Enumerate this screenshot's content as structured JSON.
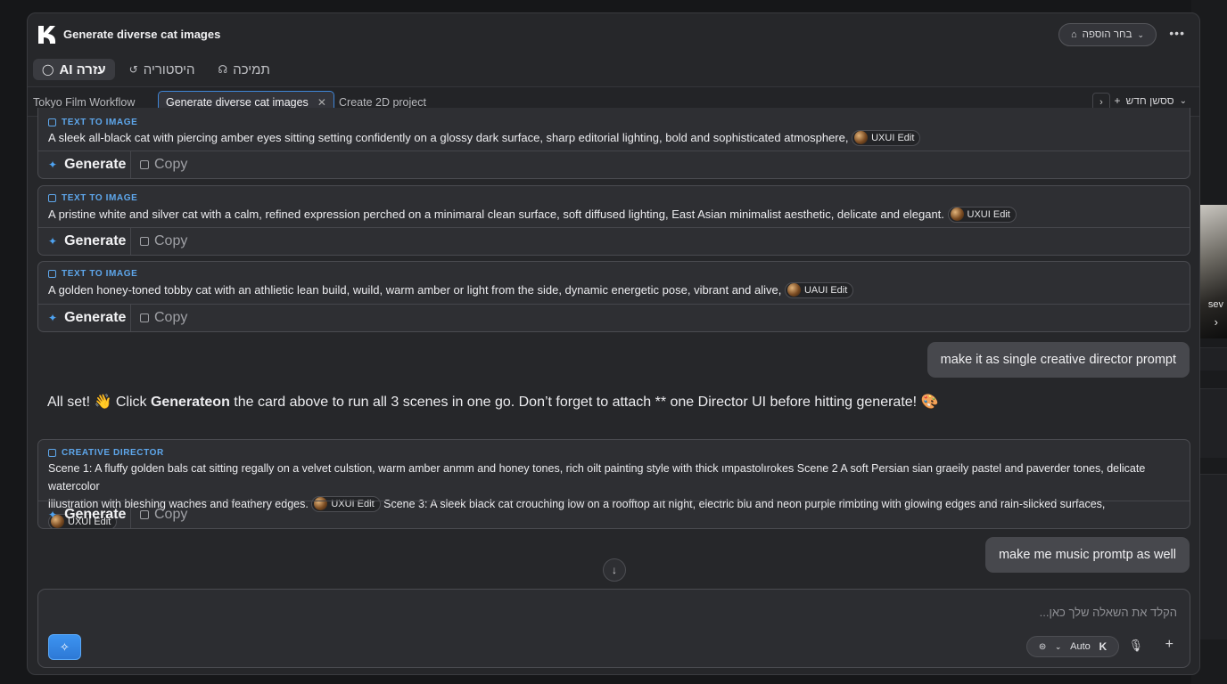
{
  "header": {
    "title": "Generate diverse cat images",
    "model_select": "בחר הוספה",
    "more": "•••"
  },
  "nav_tabs": [
    {
      "label": "AI עזרה",
      "icon": "chat-icon"
    },
    {
      "label": "היסטוריה",
      "icon": "history-icon"
    },
    {
      "label": "תמיכה",
      "icon": "headset-icon"
    }
  ],
  "workspace_tabs": {
    "items": [
      "Tokyo Film Workflow",
      "Generate diverse cat images",
      "Create 2D project"
    ],
    "new_chat": "ססשן חדש"
  },
  "cards": [
    {
      "kind": "TEXT TO IMAGE",
      "text": "A sleek all-black cat with piercing amber eyes sitting setting confidently on a glossy dark surface, sharp editorial lighting, bold and sophisticated atmosphere,",
      "chip": "UXUI Edit",
      "generate": "Generate",
      "copy": "Copy"
    },
    {
      "kind": "TEXT TO IMAGE",
      "text": "A pristine white and silver cat with a calm, refined expression perched on a minimaral clean surface, soft diffused lighting, East Asian minimalist aesthetic, delicate and elegant.",
      "chip": "UXUI Edit",
      "generate": "Generate",
      "copy": "Copy"
    },
    {
      "kind": "TEXT TO IMAGE",
      "text": "A golden honey-toned tobby cat with an athlietic lean build, wuild, warm amber or light from the side, dynamic energetic pose, vibrant and alive,",
      "chip": "UAUI Edit",
      "generate": "Generate",
      "copy": "Copy"
    }
  ],
  "user_message_1": "make it as single creative director prompt",
  "ai_message": {
    "prefix": "All set! 👋 Click ",
    "bold": "Generateon",
    "suffix": " the card above to run all 3 scenes in one go. Don’t forget to attach ** one Director UI before hitting generate! 🎨"
  },
  "director_card": {
    "kind": "CREATIVE DIRECTOR",
    "text_line1": "Scene 1: A fluffy golden bals cat sitting regally on a velvet culstion, warm amber anmm and honey tones, rich oilt painting style with thick ımpastolırokes Scene 2 A soft Persian sian graeily pastel and paverder tones, delicate watercolor",
    "text_line2a": "illustration with bleshing waches and feathery edges.",
    "chip1": "UXUI Edit",
    "text_line2b": "Scene 3: A sleek black cat crouching low on a roofftop aıt night, electric blu and neon purple rimbting with glowing edges and rain-slicked surfaces,",
    "chip2": "UXUI Edit",
    "generate": "Generate",
    "copy": "Copy"
  },
  "user_message_2": "make me music promtp as well",
  "composer": {
    "placeholder": "הקלד את השאלה שלך כאן...",
    "mode": "Auto"
  },
  "background": {
    "thumb_label": "sev"
  },
  "colors": {
    "accent": "#3d94f0",
    "panel": "#26272a",
    "card": "#2e2f33",
    "bubble": "#47484d"
  }
}
